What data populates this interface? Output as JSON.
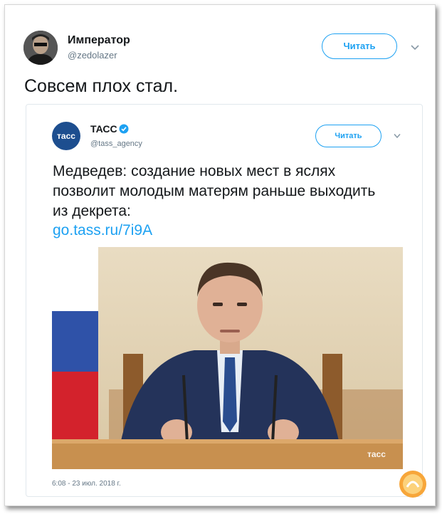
{
  "tweet": {
    "author_name": "Император",
    "author_handle": "@zedolazer",
    "follow_label": "Читать",
    "text": "Совсем плох стал."
  },
  "quoted": {
    "author_name": "ТАСС",
    "author_handle": "@tass_agency",
    "avatar_text": "тасс",
    "follow_label": "Читать",
    "text": "Медведев: создание новых мест в яслях позволит молодым матерям раньше выходить из декрета:",
    "link": "go.tass.ru/7i9A",
    "watermark": "тасс",
    "timestamp": "6:08 - 23 июл. 2018 г."
  },
  "colors": {
    "accent": "#1da1f2",
    "text": "#14171a",
    "muted": "#657786",
    "tass_blue": "#1d4e8f"
  },
  "icons": [
    "chevron-down-icon",
    "verified-badge-icon",
    "site-logo-icon"
  ]
}
